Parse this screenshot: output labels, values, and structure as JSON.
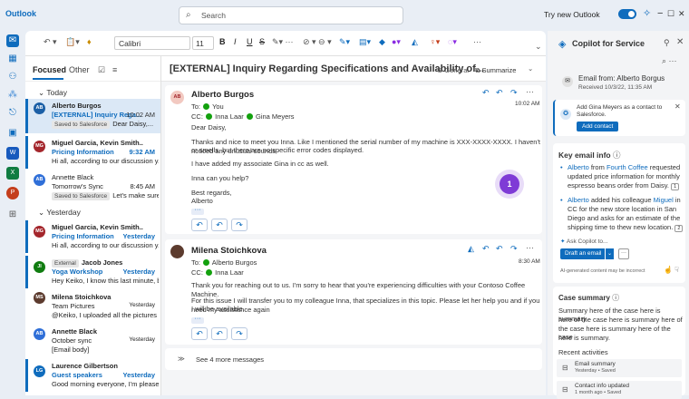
{
  "app": {
    "name": "Outlook",
    "search_placeholder": "Search",
    "try_new": "Try new Outlook"
  },
  "window": {
    "minimize": "−",
    "maximize": "☐",
    "close": "✕"
  },
  "ribbon": {
    "font": "Calibri",
    "size": "11",
    "bold": "B",
    "italic": "I",
    "underline": "U",
    "strike": "S"
  },
  "list": {
    "tab_focused": "Focused",
    "tab_other": "Other",
    "group_today": "Today",
    "group_yesterday": "Yesterday",
    "mails": [
      {
        "initials": "AB",
        "color": "#1b5fa6",
        "from": "Alberto Burgos",
        "subject": "[EXTERNAL] Inquiry Rega...",
        "time": "10:02 AM",
        "tag": "Saved to Salesforce",
        "preview": "Dear Daisy,..."
      },
      {
        "initials": "MG",
        "color": "#a4262c",
        "from": "Miguel Garcia, Kevin Smith..",
        "subject": "Pricing Information",
        "time": "9:32 AM",
        "preview": "Hi all, according to our discussion y..."
      },
      {
        "initials": "AB",
        "color": "#2f6fd8",
        "from": "Annette Black",
        "subject": "Tomorrow's Sync",
        "time": "8:45 AM",
        "tag": "Saved to Salesforce",
        "preview": "Let's make sure..."
      },
      {
        "initials": "MG",
        "color": "#a4262c",
        "from": "Miguel Garcia, Kevin Smith..",
        "subject": "Pricing Information",
        "time": "Yesterday",
        "preview": "Hi all, according to our discussion y..."
      },
      {
        "initials": "JI",
        "color": "#107c10",
        "from": "Jacob Jones",
        "tag": "External",
        "subject": "Yoga Workshop",
        "time": "Yesterday",
        "preview": "Hey Keiko, I know this last minute, b..."
      },
      {
        "initials": "MS",
        "color": "#5c3b2e",
        "from": "Milena Stoichkova",
        "subject": "Team Pictures",
        "time": "Yesterday",
        "preview": "@Keiko, I uploaded all the pictures f..."
      },
      {
        "initials": "AB",
        "color": "#2f6fd8",
        "from": "Annette Black",
        "subject": "October sync",
        "time": "Yesterday",
        "preview": "[Email body]"
      },
      {
        "initials": "LG",
        "color": "#0f6cbd",
        "from": "Laurence Gilbertson",
        "subject": "Guest speakers",
        "time": "Yesterday",
        "preview": "Good morning everyone, I'm please..."
      }
    ]
  },
  "reading": {
    "subject": "[EXTERNAL] Inquiry Regarding Specifications and Availability of...",
    "category": "General",
    "summarize": "Summarize",
    "msg1": {
      "initials": "AB",
      "from": "Alberto Burgos",
      "to": "To:",
      "to_name": "You",
      "cc": "CC:",
      "cc_1": "Inna Laar",
      "cc_2": "Gina Meyers",
      "time": "10:02 AM",
      "greeting": "Dear Daisy,",
      "p1": "Thanks and nice to meet you Inna. Like I mentioned the serial number of my machine is XXX-XXXX-XXXX. I haven't noticed any unusual sounds",
      "p1b": "or smells, but there are no specific error codes displayed.",
      "p2": "I have added my associate Gina in cc as well.",
      "p3": "Inna can you help?",
      "s1": "Best regards,",
      "s2": "Alberto"
    },
    "msg2": {
      "from": "Milena Stoichkova",
      "to": "To:",
      "to_name": "Alberto Burgos",
      "cc": "CC:",
      "cc_1": "Inna Laar",
      "time": "8:30 AM",
      "p1": "Thank you for reaching out to us. I'm sorry to hear that you're experiencing difficulties with your Contoso Coffee Machine.",
      "p2": "For this issue I will transfer you to my colleague Inna, that specializes in this topic. Please let her help you and if you need my assistance again",
      "p2b": "I will be available."
    },
    "more": "See 4 more messages",
    "badge": "1"
  },
  "copilot": {
    "title": "Copilot for Service",
    "email_from": "Email from: Alberto Borgus",
    "received": "Received 10/3/22, 11:35 AM",
    "add_line1": "Add Gina Meyers as a contact to",
    "add_line2": "Salesforce.",
    "add_btn": "Add contact",
    "key_title": "Key email info",
    "k1": [
      "Alberto",
      " from ",
      "Fourth Coffee",
      " requested"
    ],
    "k1b": "updated price information for monthly",
    "k1c": "espresso beans order from Daisy.",
    "k1ref": "1",
    "k2": [
      "Alberto",
      " added his colleague ",
      "Miguel",
      " in"
    ],
    "k2b": "CC for the new store location in San",
    "k2c": "Diego and asks for an estimate of the",
    "k2d": "shipping time to thew new location.",
    "k2ref": "2",
    "ask": "Ask Copilot to...",
    "draft": "Draft an email",
    "disclaimer": "AI-generated content may be incorrect",
    "case_title": "Case summary",
    "case_lines": [
      "Summary here of the case here is summary",
      "here of the case here is summary here of",
      "the case here is summary here of the case",
      "here is summary."
    ],
    "recent": "Recent activities",
    "act1": "Email summary",
    "act1b": "Yesterday • Saved",
    "act2": "Contact info updated",
    "act2b": "1 month ago • Saved"
  }
}
